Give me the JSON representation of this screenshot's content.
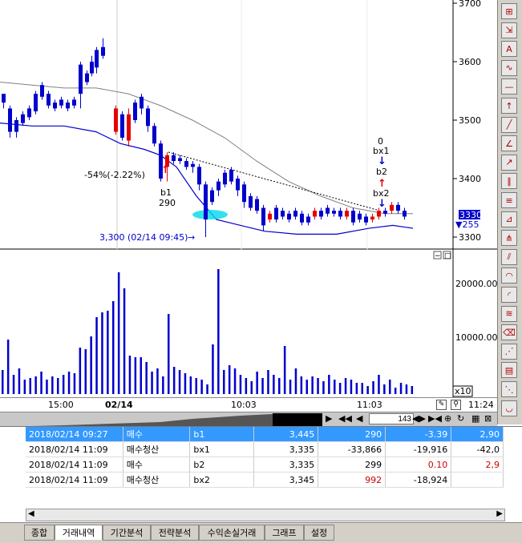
{
  "price_axis": {
    "labels": [
      "3700",
      "3600",
      "3500",
      "3400",
      "3300"
    ],
    "current_price": "3330",
    "change": "▼255"
  },
  "volume_axis": {
    "labels": [
      "20000.00",
      "10000.00"
    ],
    "multiplier": "x10"
  },
  "time_axis": {
    "labels": [
      "15:00",
      "02/14",
      "10:03",
      "11:03"
    ],
    "current_time": "11:24"
  },
  "annotations": {
    "trend_pct": "-54%(-2.22%)",
    "b1": "b1",
    "b1_qty": "290",
    "low_note": "3,300 (02/14 09:45)",
    "sig_zero": "0",
    "sig_bx1": "bx1",
    "sig_b2": "b2",
    "sig_bx2": "bx2",
    "arrow_down": "↓",
    "arrow_up": "↑"
  },
  "scroll": {
    "value": "143"
  },
  "trades": [
    {
      "date": "2018/02/14 09:27",
      "type": "매수",
      "sig": "b1",
      "price": "3,445",
      "qty": "290",
      "pl": "-3.39",
      "cum": "2,90"
    },
    {
      "date": "2018/02/14 11:09",
      "type": "매수청산",
      "sig": "bx1",
      "price": "3,335",
      "qty": "-33,866",
      "pl": "-19,916",
      "cum": "-42,0"
    },
    {
      "date": "2018/02/14 11:09",
      "type": "매수",
      "sig": "b2",
      "price": "3,335",
      "qty": "299",
      "pl": "0.10",
      "cum": "2,9"
    },
    {
      "date": "2018/02/14 11:09",
      "type": "매수청산",
      "sig": "bx2",
      "price": "3,345",
      "qty": "992",
      "pl": "-18,924",
      "cum": ""
    }
  ],
  "tabs": [
    "종합",
    "거래내역",
    "기간분석",
    "전략분석",
    "수익손실거래",
    "그래프",
    "설정"
  ],
  "active_tab": 1,
  "colors": {
    "up": "#e60000",
    "down": "#0000cc",
    "ma": "#808080",
    "band": "#0000cc",
    "selected": "#3399ff"
  }
}
